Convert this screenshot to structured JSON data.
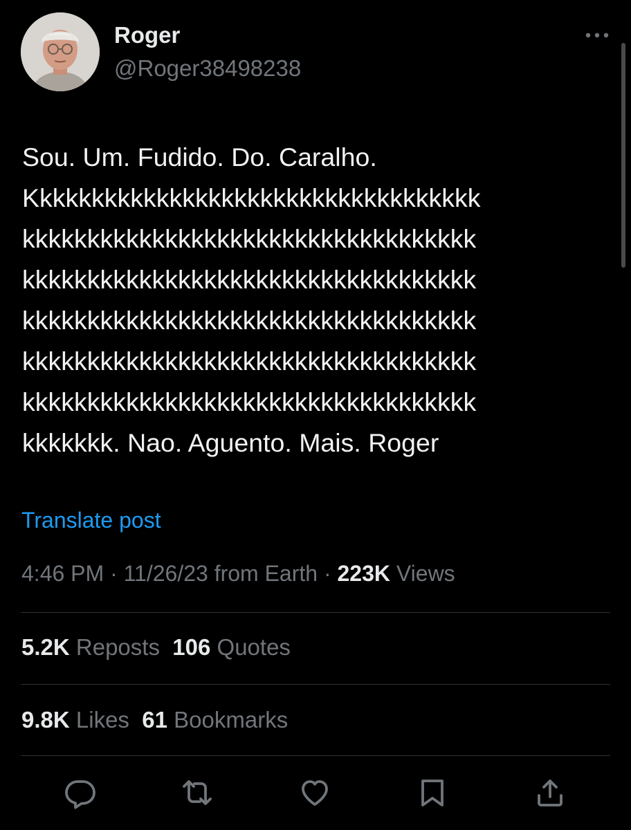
{
  "author": {
    "display_name": "Roger",
    "handle": "@Roger38498238"
  },
  "tweet": {
    "lines": [
      "Sou. Um. Fudido. Do. Caralho.",
      "Kkkkkkkkkkkkkkkkkkkkkkkkkkkkkkkkkkk",
      "kkkkkkkkkkkkkkkkkkkkkkkkkkkkkkkkkkk",
      "kkkkkkkkkkkkkkkkkkkkkkkkkkkkkkkkkkk",
      "kkkkkkkkkkkkkkkkkkkkkkkkkkkkkkkkkkk",
      "kkkkkkkkkkkkkkkkkkkkkkkkkkkkkkkkkkk",
      "kkkkkkkkkkkkkkkkkkkkkkkkkkkkkkkkkkk",
      "kkkkkkk. Nao. Aguento. Mais. Roger"
    ],
    "translate_label": "Translate post"
  },
  "meta": {
    "time": "4:46 PM",
    "separator": " · ",
    "date": "11/26/23",
    "source": " from Earth",
    "views_count": "223K",
    "views_label": " Views"
  },
  "stats": {
    "reposts_count": "5.2K",
    "reposts_label": " Reposts",
    "quotes_count": "106",
    "quotes_label": " Quotes",
    "likes_count": "9.8K",
    "likes_label": " Likes",
    "bookmarks_count": "61",
    "bookmarks_label": " Bookmarks"
  },
  "icons": {
    "more": "more-horizontal-icon",
    "reply": "reply-icon",
    "repost": "repost-icon",
    "like": "heart-icon",
    "bookmark": "bookmark-icon",
    "share": "share-icon"
  },
  "colors": {
    "background": "#000000",
    "text_primary": "#e7e9ea",
    "text_secondary": "#71767b",
    "link": "#1d9bf0",
    "divider": "#2f3336"
  }
}
